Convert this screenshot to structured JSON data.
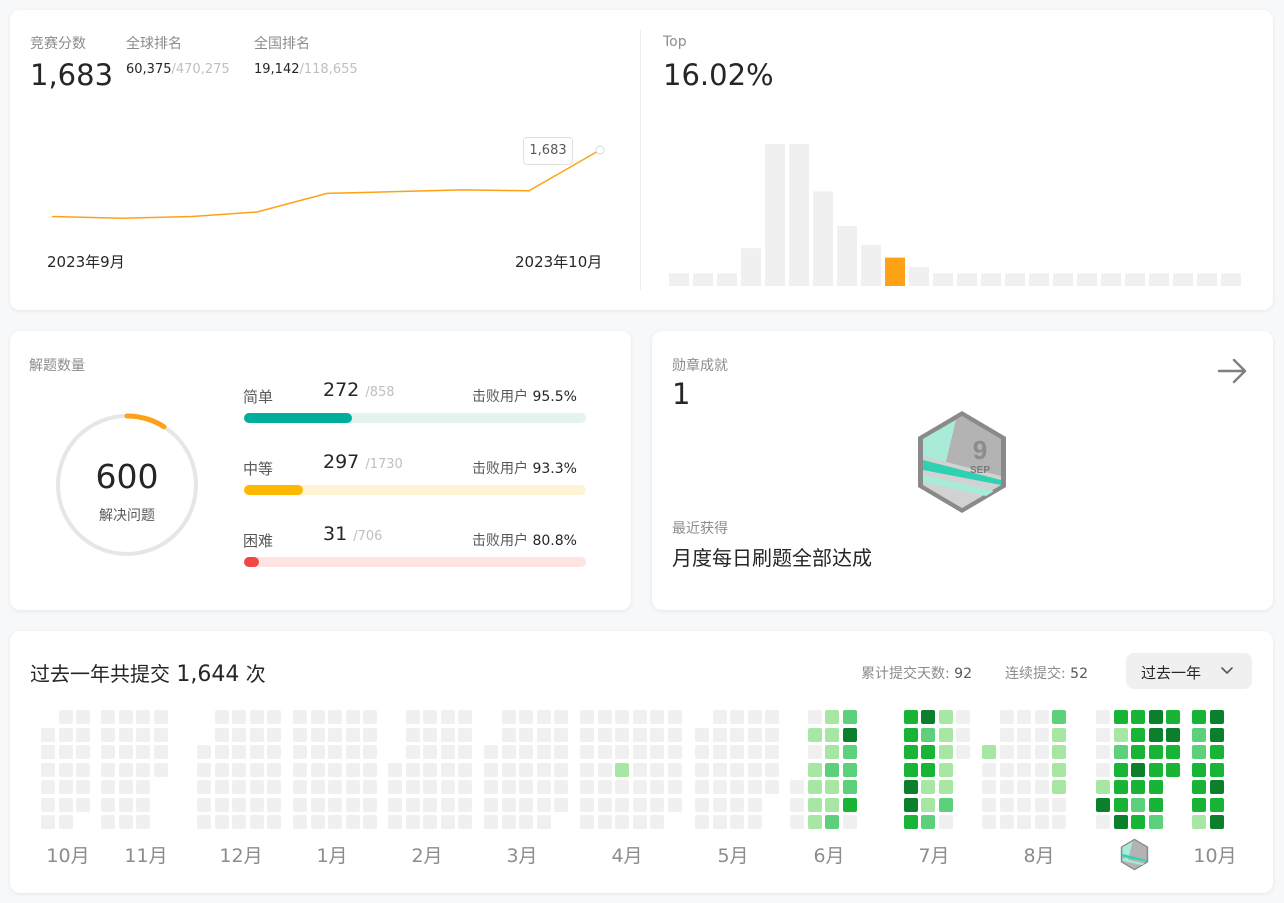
{
  "contest": {
    "score_label": "竞赛分数",
    "score_value": "1,683",
    "global_label": "全球排名",
    "global_rank": "60,375",
    "global_total": "/470,275",
    "national_label": "全国排名",
    "national_rank": "19,142",
    "national_total": "/118,655",
    "tooltip": "1,683",
    "x_start": "2023年9月",
    "x_end": "2023年10月",
    "line_color": "#ffa116",
    "chart_data": {
      "type": "line",
      "x": [
        "2023年9月",
        "",
        "",
        "",
        "",
        "",
        "",
        "",
        "2023年10月"
      ],
      "values": [
        1608,
        1606,
        1608,
        1613,
        1634,
        1636,
        1638,
        1637,
        1683
      ]
    }
  },
  "top": {
    "label": "Top",
    "value": "16.02%",
    "highlight_color": "#ffa116",
    "bar_color": "#f0f0f0",
    "chart_data": {
      "type": "bar",
      "values": [
        4,
        4,
        4,
        12,
        45,
        45,
        30,
        19,
        13,
        9,
        6,
        4,
        4,
        4,
        4,
        4,
        4,
        4,
        4,
        4,
        4,
        4,
        4,
        4
      ],
      "highlight_index": 9
    }
  },
  "solved": {
    "label": "解题数量",
    "total": "600",
    "total_caption": "解决问题",
    "beat_label": "击败用户",
    "ring_fraction": 0.09,
    "rows": [
      {
        "name": "简单",
        "count": "272",
        "total": "/858",
        "beat": "95.5%",
        "fraction": 0.317,
        "color": "#00af9b",
        "track": "#e3f4ec"
      },
      {
        "name": "中等",
        "count": "297",
        "total": "/1730",
        "beat": "93.3%",
        "fraction": 0.172,
        "color": "#ffb800",
        "track": "#fff3d6"
      },
      {
        "name": "困难",
        "count": "31",
        "total": "/706",
        "beat": "80.8%",
        "fraction": 0.044,
        "color": "#ef4743",
        "track": "#fde4e3"
      }
    ]
  },
  "badges": {
    "label": "勋章成就",
    "count": "1",
    "recent_label": "最近获得",
    "recent_name": "月度每日刷题全部达成",
    "badge_number": "9",
    "badge_month": "SEP"
  },
  "heatmap": {
    "title_prefix": "过去一年共提交",
    "title_count": "1,644",
    "title_suffix": "次",
    "days_label": "累计提交天数:",
    "days_value": "92",
    "streak_label": "连续提交:",
    "streak_value": "52",
    "range_select": "过去一年",
    "months": [
      "10月",
      "11月",
      "12月",
      "1月",
      "2月",
      "3月",
      "4月",
      "5月",
      "6月",
      "7月",
      "8月",
      "9月",
      "10月"
    ],
    "colors": [
      "#f0f0f0",
      "#a8e6a3",
      "#5cd07a",
      "#17b436",
      "#0b7f2b"
    ]
  }
}
